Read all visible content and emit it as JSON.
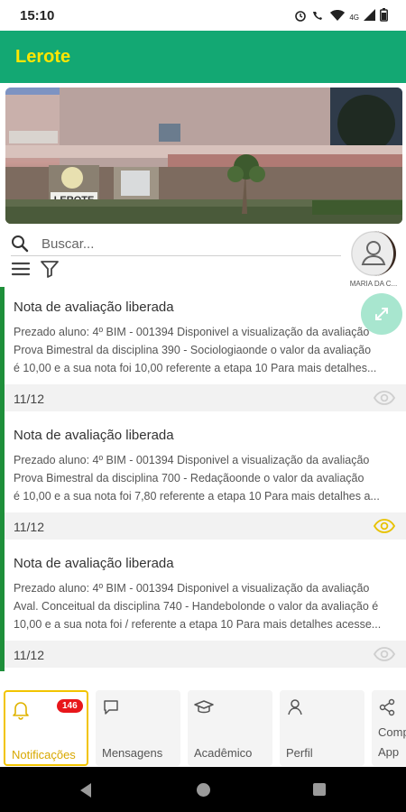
{
  "status_bar": {
    "time": "15:10",
    "network": "4G"
  },
  "app_bar": {
    "title": "Lerote"
  },
  "banner": {
    "sign_text": "LEROTE"
  },
  "search": {
    "placeholder": "Buscar..."
  },
  "profile": {
    "name": "MARIA DA C..."
  },
  "notifications": [
    {
      "title": "Nota de avaliação liberada",
      "lines": [
        "Prezado aluno: 4º BIM - 001394 Disponivel a visualização da avaliação",
        "Prova Bimestral da disciplina 390 - Sociologiaonde o valor da avaliação",
        "é 10,00  e a sua nota foi 10,00  referente a etapa 10 Para mais detalhes..."
      ],
      "date": "11/12",
      "read": false,
      "eye_color": "#cfcfcf"
    },
    {
      "title": "Nota de avaliação liberada",
      "lines": [
        "Prezado aluno: 4º BIM - 001394 Disponivel a visualização da avaliação",
        "Prova Bimestral da disciplina 700 - Redaçãoonde o valor da avaliação",
        "é 10,00  e a sua nota foi 7,80  referente a etapa 10 Para mais detalhes a..."
      ],
      "date": "11/12",
      "read": true,
      "eye_color": "#e8c200"
    },
    {
      "title": "Nota de avaliação liberada",
      "lines": [
        "Prezado aluno: 4º BIM - 001394 Disponivel a visualização da avaliação",
        "Aval. Conceitual da disciplina 740 - Handebolonde o valor da avaliação é",
        "10,00  e a sua nota foi /  referente a etapa 10 Para mais detalhes acesse..."
      ],
      "date": "11/12",
      "read": false,
      "eye_color": "#cfcfcf"
    }
  ],
  "bottom_nav": {
    "items": [
      {
        "label": "Notificações",
        "icon": "bell-icon",
        "badge": "146",
        "active": true
      },
      {
        "label": "Mensagens",
        "icon": "chat-icon",
        "active": false
      },
      {
        "label": "Acadêmico",
        "icon": "graduation-cap-icon",
        "active": false
      },
      {
        "label": "Perfil",
        "icon": "person-icon",
        "active": false
      },
      {
        "label": "Compartilhar App",
        "label_line1": "Comp",
        "label_line2": "App",
        "icon": "share-icon",
        "active": false
      }
    ]
  },
  "colors": {
    "app_bar": "#13a873",
    "title": "#ffe600",
    "card_accent": "#1e8f3a",
    "active_nav": "#f2c400",
    "badge": "#e8161b"
  }
}
